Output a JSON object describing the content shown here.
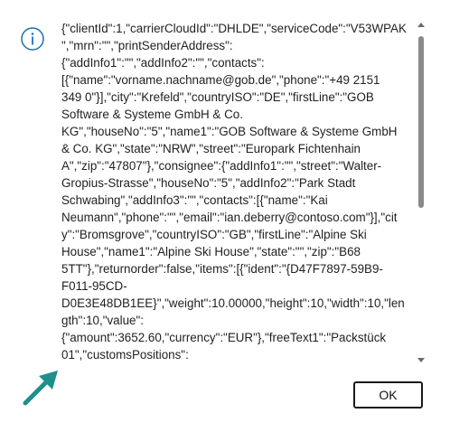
{
  "dialog": {
    "icon": "info-icon",
    "message_lines": [
      "{\"clientId\":1,\"carrierCloudId\":\"DHLDE\",\"serviceCode\":\"V53WPAK",
      "\",\"mrn\":\"\",\"printSenderAddress\":",
      "{\"addInfo1\":\"\",\"addInfo2\":\"\",\"contacts\":",
      "[{\"name\":\"vorname.nachname@gob.de\",\"phone\":\"+49 2151",
      "349 0\"}],\"city\":\"Krefeld\",\"countryISO\":\"DE\",\"firstLine\":\"GOB",
      "Software & Systeme GmbH & Co.",
      "KG\",\"houseNo\":\"5\",\"name1\":\"GOB Software & Systeme GmbH",
      "& Co. KG\",\"state\":\"NRW\",\"street\":\"Europark Fichtenhain",
      "A\",\"zip\":\"47807\"},\"consignee\":{\"addInfo1\":\"\",\"street\":\"Walter-",
      "Gropius-Strasse\",\"houseNo\":\"5\",\"addInfo2\":\"Park Stadt",
      "Schwabing\",\"addInfo3\":\"\",\"contacts\":[{\"name\":\"Kai",
      "Neumann\",\"phone\":\"\",\"email\":\"ian.deberry@contoso.com\"}],\"cit",
      "y\":\"Bromsgrove\",\"countryISO\":\"GB\",\"firstLine\":\"Alpine Ski",
      "House\",\"name1\":\"Alpine Ski House\",\"state\":\"\",\"zip\":\"B68",
      "5TT\"},\"returnorder\":false,\"items\":[{\"ident\":\"{D47F7897-59B9-",
      "F011-95CD-",
      "D0E3E48DB1EE}\",\"weight\":10.00000,\"height\":10,\"width\":10,\"len",
      "gth\":10,\"value\":",
      "{\"amount\":3652.60,\"currency\":\"EUR\"},\"freeText1\":\"Packstück",
      "01\",\"customsPositions\":"
    ],
    "ok_label": "OK",
    "annotation_arrow": "arrow-icon",
    "colors": {
      "icon_blue": "#1f6fb2",
      "arrow_teal": "#1f8f8c",
      "text": "#1f1f1f",
      "button_border": "#1a1a1a"
    }
  }
}
